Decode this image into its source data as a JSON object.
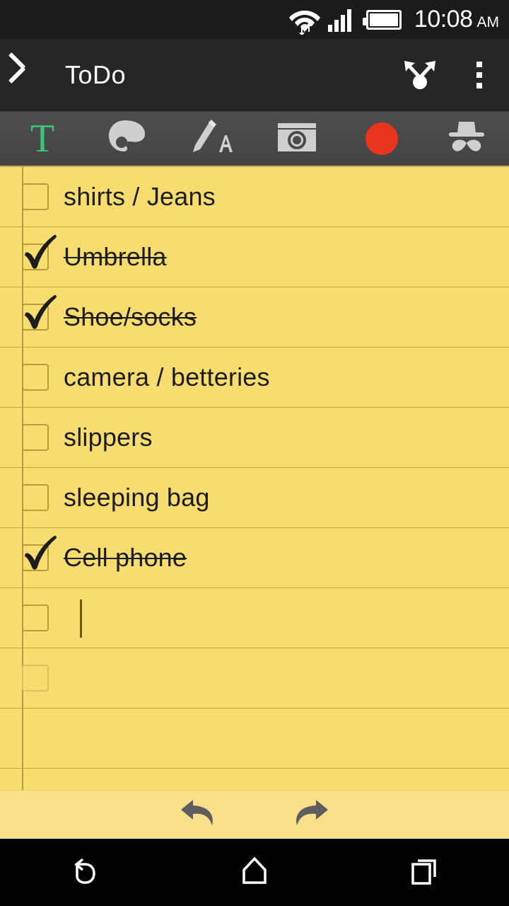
{
  "statusbar": {
    "time": "10:08",
    "ampm": "AM",
    "icons": [
      "wifi-icon",
      "signal-icon",
      "battery-icon"
    ]
  },
  "actionbar": {
    "back_icon": "back-chevron-icon",
    "title": "ToDo",
    "share_icon": "share-icon",
    "overflow_icon": "overflow-menu-icon"
  },
  "toolbar": {
    "items": [
      {
        "name": "text-tool",
        "icon": "text-T-icon",
        "label": "T",
        "color": "#3ec27a"
      },
      {
        "name": "color-tool",
        "icon": "palette-icon",
        "color": "#cfcfcf"
      },
      {
        "name": "draw-tool",
        "icon": "pencil-a-icon",
        "color": "#cfcfcf"
      },
      {
        "name": "camera-tool",
        "icon": "camera-icon",
        "color": "#cfcfcf"
      },
      {
        "name": "record-tool",
        "icon": "record-dot-icon",
        "color": "#e8341c"
      },
      {
        "name": "sticker-tool",
        "icon": "hat-mustache-icon",
        "color": "#cfcfcf"
      }
    ]
  },
  "note": {
    "paper_color": "#f7dc70",
    "rule_color": "#c6a73e",
    "margin_color": "#ab912f",
    "items": [
      {
        "text": "shirts / Jeans",
        "checked": false
      },
      {
        "text": "Umbrella",
        "checked": true
      },
      {
        "text": "Shoe/socks",
        "checked": true
      },
      {
        "text": "camera / betteries",
        "checked": false
      },
      {
        "text": "slippers",
        "checked": false
      },
      {
        "text": "sleeping bag",
        "checked": false
      },
      {
        "text": "Cell phone",
        "checked": true
      },
      {
        "text": "",
        "checked": false,
        "editing": true
      },
      {
        "text": "",
        "checked": false,
        "faded": true
      },
      {
        "text": "",
        "checked": false,
        "empty": true
      }
    ]
  },
  "undobar": {
    "undo_label": "undo-arrow-icon",
    "redo_label": "redo-arrow-icon"
  },
  "navbar": {
    "back": "nav-back-icon",
    "home": "nav-home-icon",
    "recents": "nav-recents-icon"
  }
}
